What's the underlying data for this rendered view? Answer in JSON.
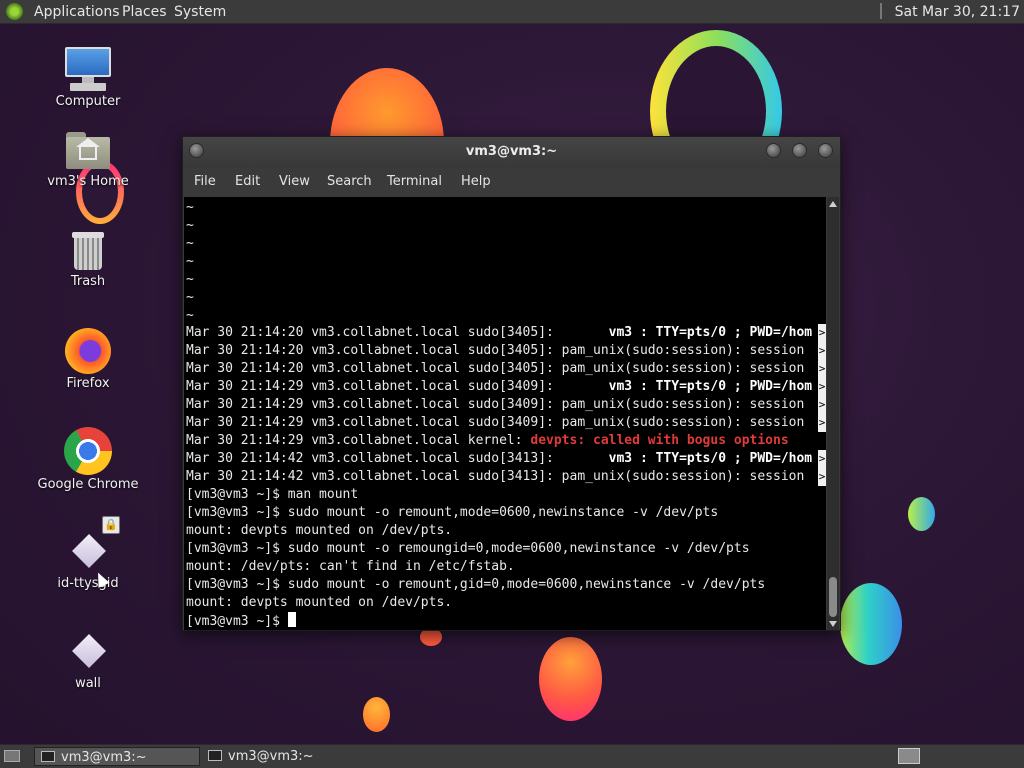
{
  "top_panel": {
    "menus": [
      "Applications",
      "Places",
      "System"
    ],
    "clock": "Sat Mar 30, 21:17"
  },
  "desktop_icons": [
    {
      "label": "Computer",
      "icon": "computer-icon"
    },
    {
      "label": "vm3's Home",
      "icon": "home-folder-icon"
    },
    {
      "label": "Trash",
      "icon": "trash-icon"
    },
    {
      "label": "Firefox",
      "icon": "firefox-icon"
    },
    {
      "label": "Google Chrome",
      "icon": "chrome-icon"
    },
    {
      "label": "id-ttysgid",
      "icon": "file-icon"
    },
    {
      "label": "wall",
      "icon": "file-icon"
    }
  ],
  "window": {
    "title": "vm3@vm3:~",
    "menu": [
      "File",
      "Edit",
      "View",
      "Search",
      "Terminal",
      "Help"
    ]
  },
  "terminal": {
    "tildes": [
      "~",
      "~",
      "~",
      "~",
      "~",
      "~",
      "~"
    ],
    "log": [
      {
        "prefix": "Mar 30 21:14:20 vm3.collabnet.local sudo[3405]:       ",
        "bold": "vm3 : TTY=pts/0 ; PWD=/hom",
        "red": "",
        "trunc": true
      },
      {
        "prefix": "Mar 30 21:14:20 vm3.collabnet.local sudo[3405]: pam_unix(sudo:session): session",
        "bold": "",
        "red": "",
        "trunc": true
      },
      {
        "prefix": "Mar 30 21:14:20 vm3.collabnet.local sudo[3405]: pam_unix(sudo:session): session",
        "bold": "",
        "red": "",
        "trunc": true
      },
      {
        "prefix": "Mar 30 21:14:29 vm3.collabnet.local sudo[3409]:       ",
        "bold": "vm3 : TTY=pts/0 ; PWD=/hom",
        "red": "",
        "trunc": true
      },
      {
        "prefix": "Mar 30 21:14:29 vm3.collabnet.local sudo[3409]: pam_unix(sudo:session): session",
        "bold": "",
        "red": "",
        "trunc": true
      },
      {
        "prefix": "Mar 30 21:14:29 vm3.collabnet.local sudo[3409]: pam_unix(sudo:session): session",
        "bold": "",
        "red": "",
        "trunc": true
      },
      {
        "prefix": "Mar 30 21:14:29 vm3.collabnet.local kernel: ",
        "bold": "",
        "red": "devpts: called with bogus options",
        "trunc": false
      },
      {
        "prefix": "Mar 30 21:14:42 vm3.collabnet.local sudo[3413]:       ",
        "bold": "vm3 : TTY=pts/0 ; PWD=/hom",
        "red": "",
        "trunc": true
      },
      {
        "prefix": "Mar 30 21:14:42 vm3.collabnet.local sudo[3413]: pam_unix(sudo:session): session",
        "bold": "",
        "red": "",
        "trunc": true
      }
    ],
    "session": [
      "[vm3@vm3 ~]$ man mount",
      "[vm3@vm3 ~]$ sudo mount -o remount,mode=0600,newinstance -v /dev/pts",
      "mount: devpts mounted on /dev/pts.",
      "[vm3@vm3 ~]$ sudo mount -o remoungid=0,mode=0600,newinstance -v /dev/pts",
      "mount: /dev/pts: can't find in /etc/fstab.",
      "[vm3@vm3 ~]$ sudo mount -o remount,gid=0,mode=0600,newinstance -v /dev/pts",
      "mount: devpts mounted on /dev/pts."
    ],
    "prompt": "[vm3@vm3 ~]$ ",
    "truncation_marker": ">"
  },
  "taskbar": {
    "tasks": [
      "vm3@vm3:~",
      "vm3@vm3:~"
    ]
  }
}
